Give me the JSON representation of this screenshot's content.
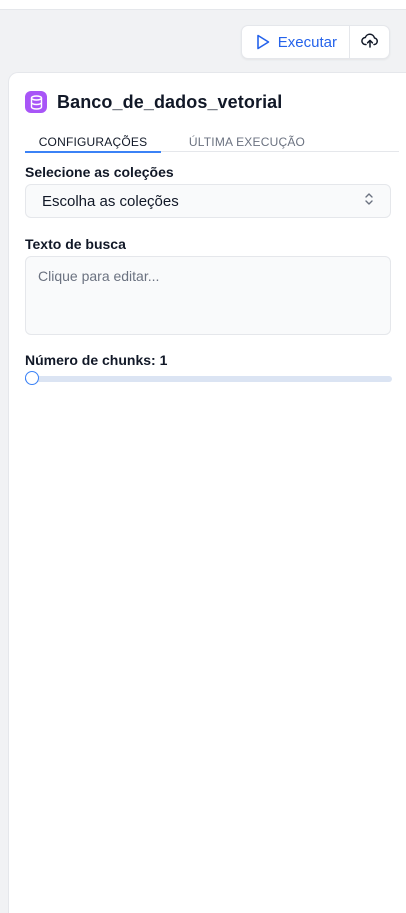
{
  "toolbar": {
    "run_label": "Executar",
    "run_icon": "play-icon",
    "upload_icon": "cloud-upload-icon",
    "accent_color": "#2563eb"
  },
  "node": {
    "title": "Banco_de_dados_vetorial",
    "icon": "database-icon",
    "icon_color": "#a855f7"
  },
  "tabs": [
    {
      "label": "CONFIGURAÇÕES",
      "active": true
    },
    {
      "label": "ÚLTIMA EXECUÇÃO",
      "active": false
    }
  ],
  "fields": {
    "collections_label": "Selecione as coleções",
    "collections_value": "Escolha as coleções",
    "search_label": "Texto de busca",
    "search_placeholder": "Clique para editar...",
    "chunks_label": "Número de chunks: 1",
    "chunks_value_fraction": 0
  }
}
